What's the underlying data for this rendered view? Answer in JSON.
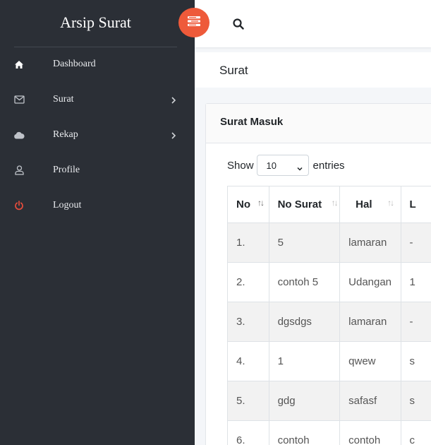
{
  "app": {
    "title": "Arsip Surat"
  },
  "sidebar": {
    "items": [
      {
        "label": "Dashboard",
        "icon": "home-icon",
        "has_submenu": false
      },
      {
        "label": "Surat",
        "icon": "envelope-icon",
        "has_submenu": true
      },
      {
        "label": "Rekap",
        "icon": "cloud-icon",
        "has_submenu": true
      },
      {
        "label": "Profile",
        "icon": "user-icon",
        "has_submenu": false
      },
      {
        "label": "Logout",
        "icon": "power-icon",
        "has_submenu": false
      }
    ]
  },
  "colors": {
    "accent": "#ee5a3a",
    "sidebar_bg": "#2b2f36",
    "logout_icon": "#e74c3c"
  },
  "page": {
    "title": "Surat"
  },
  "card": {
    "title": "Surat Masuk"
  },
  "table_controls": {
    "show_label": "Show",
    "entries_value": "10",
    "entries_label": "entries"
  },
  "table": {
    "headers": [
      "No",
      "No Surat",
      "Hal",
      "L"
    ],
    "rows": [
      {
        "no": "1.",
        "no_surat": "5",
        "hal": "lamaran",
        "l": "-"
      },
      {
        "no": "2.",
        "no_surat": "contoh 5",
        "hal": "Udangan",
        "l": "1"
      },
      {
        "no": "3.",
        "no_surat": "dgsdgs",
        "hal": "lamaran",
        "l": "-"
      },
      {
        "no": "4.",
        "no_surat": "1",
        "hal": "qwew",
        "l": "s"
      },
      {
        "no": "5.",
        "no_surat": "gdg",
        "hal": "safasf",
        "l": "s"
      },
      {
        "no": "6.",
        "no_surat": "contoh",
        "hal": "contoh",
        "l": "c"
      }
    ]
  }
}
